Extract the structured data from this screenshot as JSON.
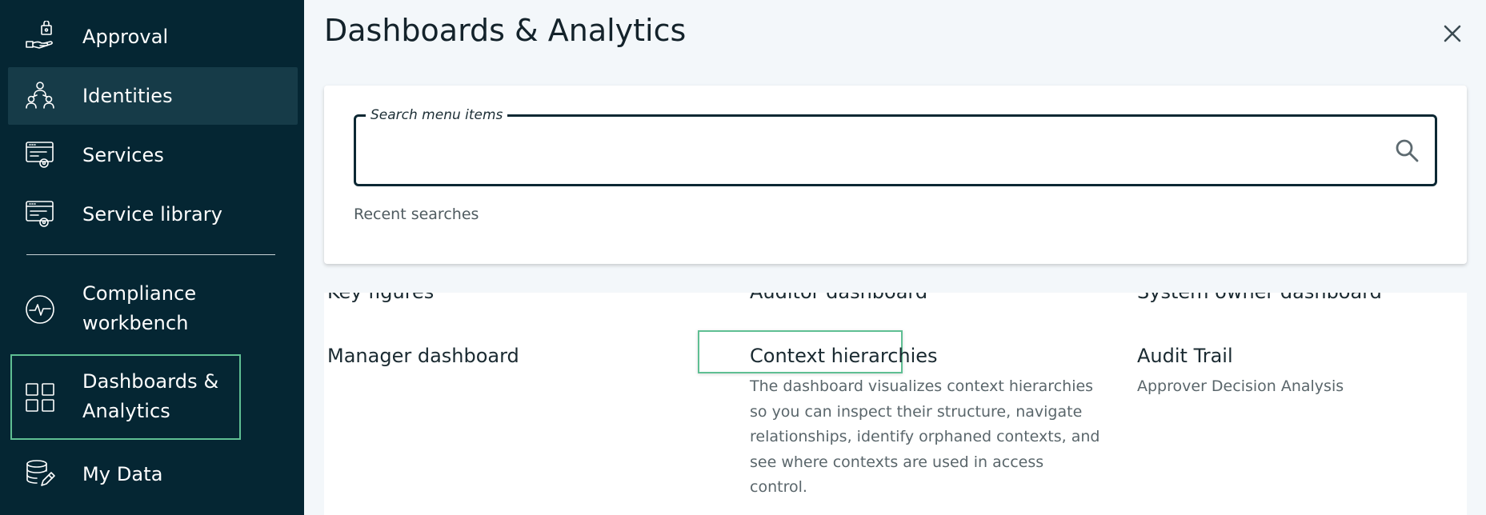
{
  "sidebar": {
    "items": [
      {
        "label": "Approval",
        "icon": "approval-icon"
      },
      {
        "label": "Identities",
        "icon": "identities-icon",
        "selected": true
      },
      {
        "label": "Services",
        "icon": "services-icon"
      },
      {
        "label": "Service library",
        "icon": "service-library-icon"
      },
      {
        "label_line1": "Compliance",
        "label_line2": "workbench",
        "icon": "compliance-icon"
      },
      {
        "label_line1": "Dashboards &",
        "label_line2": "Analytics",
        "icon": "dashboards-icon",
        "highlighted": true
      },
      {
        "label": "My Data",
        "icon": "my-data-icon"
      }
    ]
  },
  "panel": {
    "title": "Dashboards & Analytics",
    "close_icon": "close-icon"
  },
  "search": {
    "legend": "Search menu items",
    "value": "",
    "placeholder": "",
    "icon": "search-icon",
    "recent_label": "Recent searches"
  },
  "results": {
    "cut_off": [
      "Key figures",
      "Auditor dashboard",
      "System owner dashboard"
    ],
    "items": [
      {
        "title": "Manager dashboard",
        "description": ""
      },
      {
        "title": "Context hierarchies",
        "description": "The dashboard visualizes context hierarchies so you can inspect their structure, navigate relationships, identify orphaned contexts, and see where contexts are used in access control."
      },
      {
        "title": "Audit Trail",
        "description": "Approver Decision Analysis"
      }
    ]
  },
  "colors": {
    "sidebar_bg": "#052633",
    "sidebar_selected": "#163b48",
    "highlight_border": "#5fbf93",
    "panel_bg": "#f3f7fa",
    "search_border": "#0c2833"
  }
}
